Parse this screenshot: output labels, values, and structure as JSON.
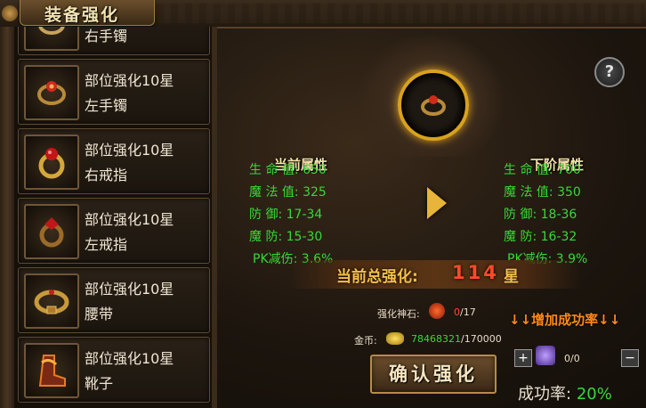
{
  "window": {
    "title": "装备强化"
  },
  "list": {
    "items": [
      {
        "level": "",
        "name": "右手镯",
        "icon": "bracelet-right-icon"
      },
      {
        "level": "部位强化10星",
        "name": "左手镯",
        "icon": "bracelet-left-icon"
      },
      {
        "level": "部位强化10星",
        "name": "右戒指",
        "icon": "ring-right-icon"
      },
      {
        "level": "部位强化10星",
        "name": "左戒指",
        "icon": "ring-left-icon"
      },
      {
        "level": "部位强化10星",
        "name": "腰带",
        "icon": "belt-icon"
      },
      {
        "level": "部位强化10星",
        "name": "靴子",
        "icon": "boots-icon"
      }
    ]
  },
  "attributes": {
    "current_title": "当前属性",
    "next_title": "下阶属性",
    "current": [
      {
        "label": "生 命 值:",
        "value": "650"
      },
      {
        "label": "魔 法 值:",
        "value": "325"
      },
      {
        "label": "防     御:",
        "value": "17-34"
      },
      {
        "label": "魔     防:",
        "value": "15-30"
      },
      {
        "label": "PK减伤:",
        "value": "3.6%"
      }
    ],
    "next": [
      {
        "label": "生 命 值:",
        "value": "700"
      },
      {
        "label": "魔 法 值:",
        "value": "350"
      },
      {
        "label": "防     御:",
        "value": "18-36"
      },
      {
        "label": "魔     防:",
        "value": "16-32"
      },
      {
        "label": "PK减伤:",
        "value": "3.9%"
      }
    ]
  },
  "total": {
    "label": "当前总强化:",
    "value": "114",
    "unit": "星"
  },
  "stone": {
    "label": "强化神石:",
    "have": "0",
    "need": "/17"
  },
  "gold": {
    "label": "金币:",
    "have": "78468321",
    "need": "/170000"
  },
  "increase_rate": {
    "label": "↓↓增加成功率↓↓",
    "count": "0/0",
    "plus": "+",
    "minus": "−"
  },
  "confirm_label": "确认强化",
  "success": {
    "label": "成功率:",
    "value": "20%"
  },
  "help_label": "?",
  "colors": {
    "green": "#38d838",
    "gold": "#f4c04a",
    "red": "#ff4a2a",
    "orange": "#ff8a1a"
  }
}
